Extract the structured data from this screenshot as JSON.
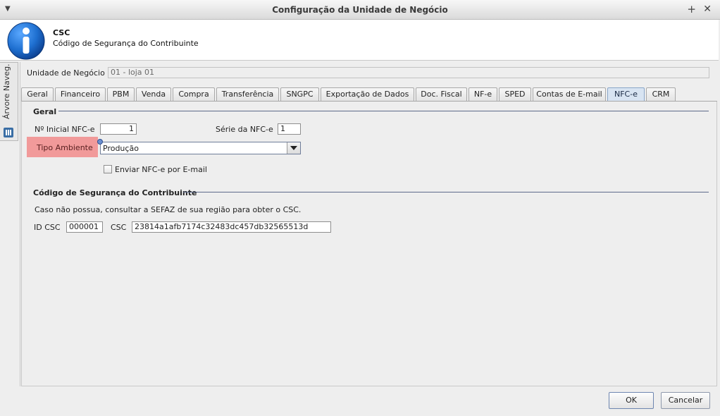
{
  "window": {
    "title": "Configuração da Unidade de Negócio",
    "menu_glyph": "▼",
    "plus_glyph": "+",
    "close_glyph": "✕"
  },
  "header": {
    "title": "CSC",
    "subtitle": "Código de Segurança do Contribuinte",
    "icon": "info-icon"
  },
  "sidenav": {
    "label": "Árvore Naveg.",
    "icon": "tree-nav-icon"
  },
  "unidade": {
    "label": "Unidade de Negócio",
    "value": "01 - loja 01"
  },
  "tabs": [
    {
      "label": "Geral"
    },
    {
      "label": "Financeiro"
    },
    {
      "label": "PBM"
    },
    {
      "label": "Venda"
    },
    {
      "label": "Compra"
    },
    {
      "label": "Transferência"
    },
    {
      "label": "SNGPC"
    },
    {
      "label": "Exportação de Dados"
    },
    {
      "label": "Doc. Fiscal"
    },
    {
      "label": "NF-e"
    },
    {
      "label": "SPED"
    },
    {
      "label": "Contas de E-mail"
    },
    {
      "label": "NFC-e",
      "active": true
    },
    {
      "label": "CRM"
    }
  ],
  "geral": {
    "section_title": "Geral",
    "inicial_label": "Nº Inicial NFC-e",
    "inicial_value": "1",
    "serie_label": "Série da NFC-e",
    "serie_value": "1",
    "tipo_ambiente_label": "Tipo Ambiente",
    "tipo_ambiente_value": "Produção",
    "enviar_email_label": "Enviar NFC-e por E-mail",
    "enviar_email_checked": false
  },
  "csc": {
    "section_title": "Código de Segurança do Contribuinte",
    "note": "Caso não possua, consultar a SEFAZ de sua região para obter o CSC.",
    "id_label": "ID CSC",
    "id_value": "000001",
    "csc_label": "CSC",
    "csc_value": "23814a1afb7174c32483dc457db32565513d"
  },
  "buttons": {
    "ok": "OK",
    "cancel": "Cancelar"
  },
  "colors": {
    "required_highlight": "#f19a9a",
    "active_tab": "#d8e4f2",
    "section_line": "#5d6a8a",
    "info_icon": "#1e6fd0"
  }
}
